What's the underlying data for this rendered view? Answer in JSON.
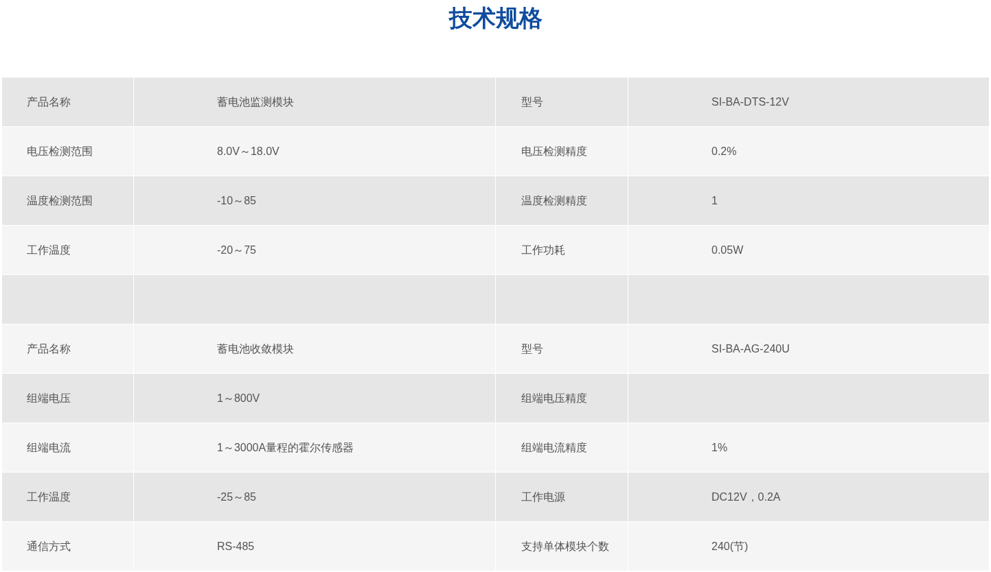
{
  "title": "技术规格",
  "table": {
    "rows": [
      {
        "kind": "data",
        "label_1": "产品名称",
        "value_1": "蓄电池监测模块",
        "label_2": "型号",
        "value_2": "SI-BA-DTS-12V"
      },
      {
        "kind": "data",
        "label_1": "电压检测范围",
        "value_1": "8.0V～18.0V",
        "label_2": "电压检测精度",
        "value_2": "0.2%"
      },
      {
        "kind": "data",
        "label_1": "温度检测范围",
        "value_1": "-10～85",
        "label_2": "温度检测精度",
        "value_2": "1"
      },
      {
        "kind": "data",
        "label_1": "工作温度",
        "value_1": "-20～75",
        "label_2": "工作功耗",
        "value_2": "0.05W"
      },
      {
        "kind": "blank"
      },
      {
        "kind": "data",
        "label_1": "产品名称",
        "value_1": "蓄电池收敛模块",
        "label_2": "型号",
        "value_2": "SI-BA-AG-240U"
      },
      {
        "kind": "data",
        "label_1": "组端电压",
        "value_1": "1～800V",
        "label_2": "组端电压精度"
      },
      {
        "kind": "data",
        "label_1": "组端电流",
        "value_1": "1～3000A量程的霍尔传感器",
        "label_2": "组端电流精度",
        "value_2": "1%"
      },
      {
        "kind": "data",
        "label_1": "工作温度",
        "value_1": "-25～85",
        "label_2": "工作电源",
        "value_2": "DC12V，0.2A"
      },
      {
        "kind": "data",
        "label_1": "通信方式",
        "value_1": "RS-485",
        "label_2": "支持单体模块个数",
        "value_2": "240(节)"
      }
    ]
  }
}
